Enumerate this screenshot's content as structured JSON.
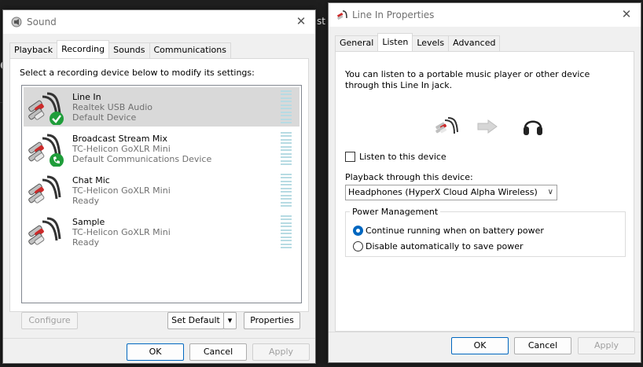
{
  "background": {
    "fragments": [
      "st",
      "e"
    ]
  },
  "sound_window": {
    "title": "Sound",
    "close": "✕",
    "tabs": [
      {
        "label": "Playback"
      },
      {
        "label": "Recording"
      },
      {
        "label": "Sounds"
      },
      {
        "label": "Communications"
      }
    ],
    "instruction": "Select a recording device below to modify its settings:",
    "devices": [
      {
        "name": "Line In",
        "line2": "Realtek USB Audio",
        "line3": "Default Device",
        "selected": true,
        "badge": "check"
      },
      {
        "name": "Broadcast Stream Mix",
        "line2": "TC-Helicon GoXLR Mini",
        "line3": "Default Communications Device",
        "selected": false,
        "badge": "phone"
      },
      {
        "name": "Chat Mic",
        "line2": "TC-Helicon GoXLR Mini",
        "line3": "Ready",
        "selected": false,
        "badge": ""
      },
      {
        "name": "Sample",
        "line2": "TC-Helicon GoXLR Mini",
        "line3": "Ready",
        "selected": false,
        "badge": ""
      }
    ],
    "buttons": {
      "configure": "Configure",
      "set_default": "Set Default",
      "set_default_arrow": "▾",
      "properties": "Properties",
      "ok": "OK",
      "cancel": "Cancel",
      "apply": "Apply"
    }
  },
  "props_window": {
    "title": "Line In Properties",
    "close": "✕",
    "tabs": [
      {
        "label": "General"
      },
      {
        "label": "Listen"
      },
      {
        "label": "Levels"
      },
      {
        "label": "Advanced"
      }
    ],
    "description": "You can listen to a portable music player or other device through this Line In jack.",
    "listen_checkbox_label": "Listen to this device",
    "listen_checked": false,
    "playback_label": "Playback through this device:",
    "playback_device": "Headphones (HyperX Cloud Alpha Wireless)",
    "power_group_title": "Power Management",
    "power_options": [
      {
        "label": "Continue running when on battery power",
        "checked": true
      },
      {
        "label": "Disable automatically to save power",
        "checked": false
      }
    ],
    "buttons": {
      "ok": "OK",
      "cancel": "Cancel",
      "apply": "Apply"
    }
  },
  "colors": {
    "accent": "#0067c0",
    "selected_row": "#d9d9d9",
    "badge_green": "#1f9d3a",
    "meter": "#b7dbe3"
  }
}
